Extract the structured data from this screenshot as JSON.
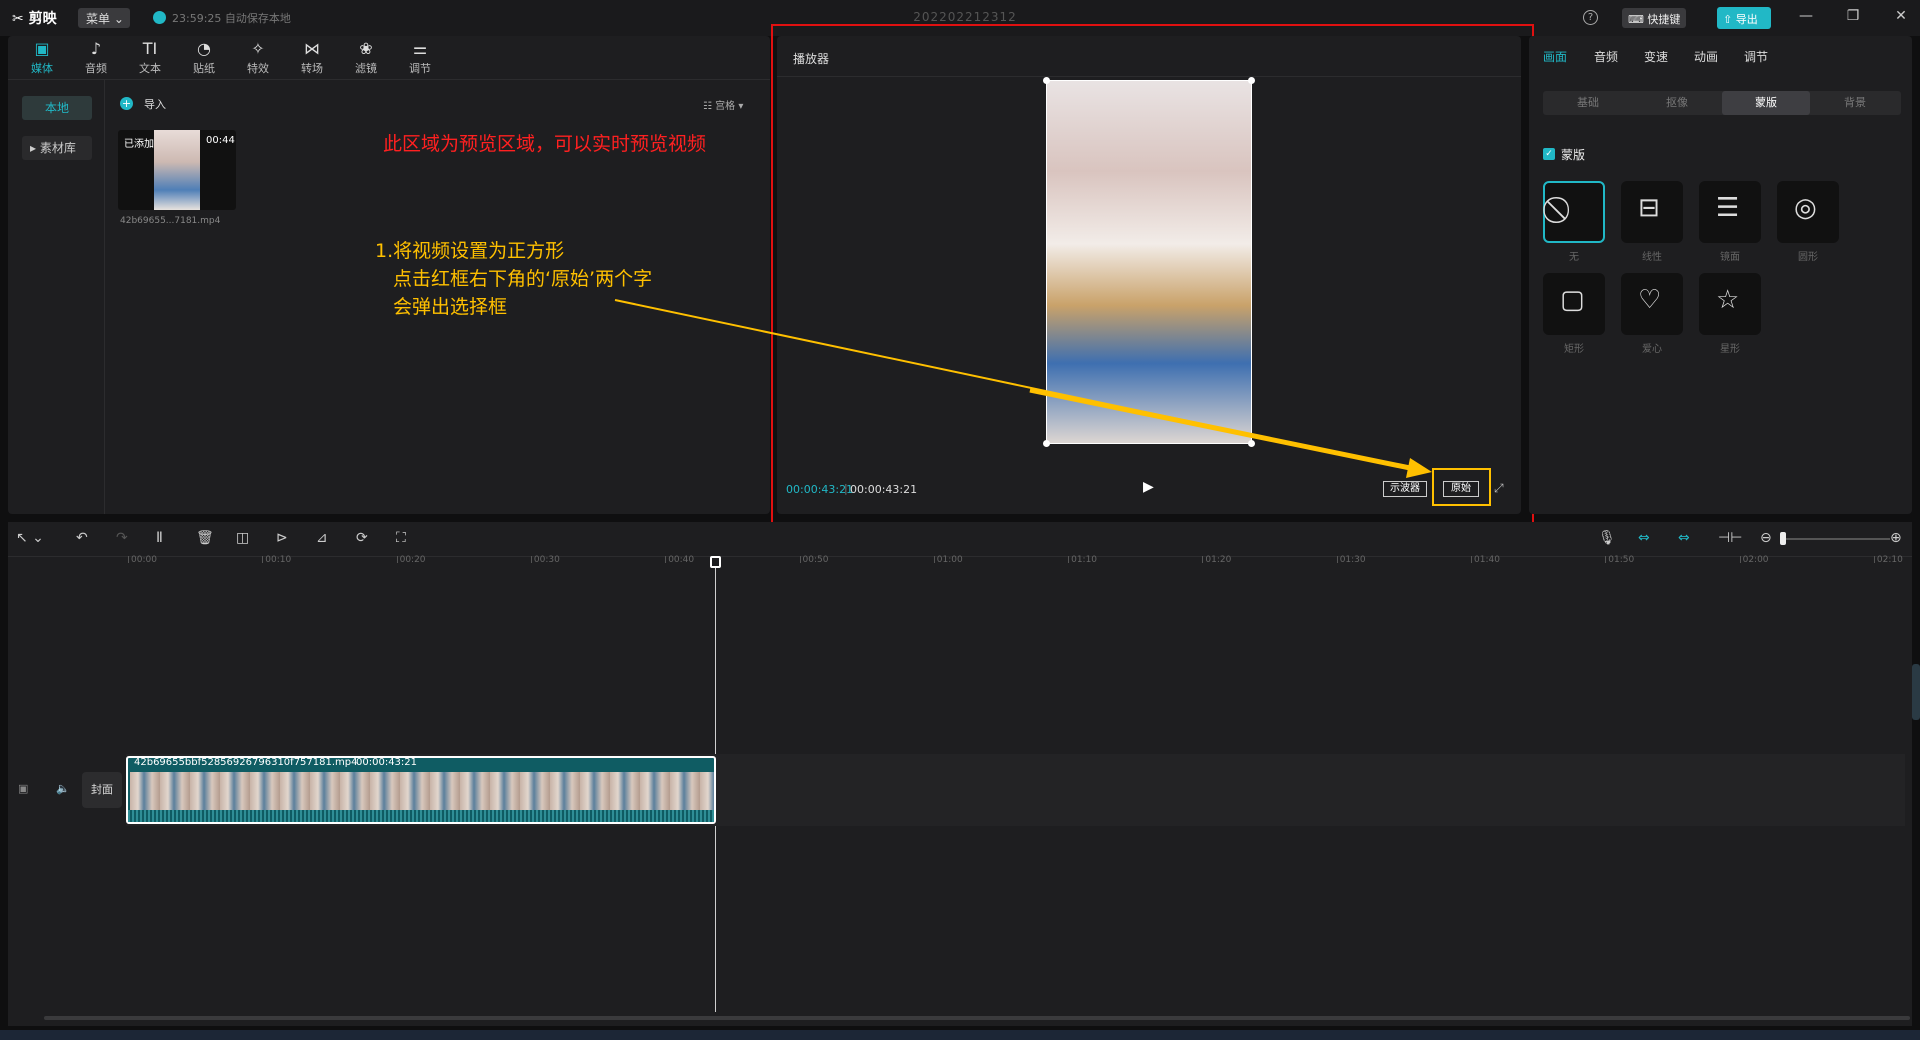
{
  "app": {
    "logo": "✂ 剪映",
    "menu": "菜单 ⌄",
    "save_status": "23:59:25 自动保存本地",
    "project_title": "202202212312",
    "help": "?",
    "shortcut": "⌨ 快捷键",
    "export": "⇧ 导出"
  },
  "window_controls": [
    "—",
    "❐",
    "✕"
  ],
  "tool_tabs": [
    {
      "icon": "▣",
      "label": "媒体"
    },
    {
      "icon": "♪",
      "label": "音频"
    },
    {
      "icon": "TI",
      "label": "文本"
    },
    {
      "icon": "◔",
      "label": "贴纸"
    },
    {
      "icon": "✧",
      "label": "特效"
    },
    {
      "icon": "⋈",
      "label": "转场"
    },
    {
      "icon": "❀",
      "label": "滤镜"
    },
    {
      "icon": "⚌",
      "label": "调节"
    }
  ],
  "media": {
    "nav_local": "本地",
    "nav_library": "▸ 素材库",
    "import": "导入",
    "view_toggle": "☷ 宫格 ▾",
    "thumb_added": "已添加",
    "thumb_duration": "00:44",
    "thumb_name": "42b69655...7181.mp4"
  },
  "annotations": {
    "preview_note": "此区域为预览区域，可以实时预览视频",
    "step_line1": "1.将视频设置为正方形",
    "step_line2": "点击红框右下角的‘原始’两个字",
    "step_line3": "会弹出选择框"
  },
  "player": {
    "title": "播放器",
    "time_current": "00:00:43:21",
    "time_total": "00:00:43:21",
    "play": "▶",
    "scope_btn": "示波器",
    "ratio_btn": "原始",
    "fullscreen": "⤢"
  },
  "right_panel": {
    "tabs": [
      "画面",
      "音频",
      "变速",
      "动画",
      "调节"
    ],
    "subtabs": [
      "基础",
      "抠像",
      "蒙版",
      "背景"
    ],
    "mask_enabled_label": "蒙版",
    "mask_check": "✓",
    "masks": [
      {
        "name": "无",
        "icon": "⃠"
      },
      {
        "name": "线性",
        "icon": "⊟"
      },
      {
        "name": "镜面",
        "icon": "☰"
      },
      {
        "name": "圆形",
        "icon": "◎"
      },
      {
        "name": "矩形",
        "icon": "▢"
      },
      {
        "name": "爱心",
        "icon": "♡"
      },
      {
        "name": "星形",
        "icon": "☆"
      }
    ]
  },
  "timeline": {
    "toolbar_left": [
      "↖ ⌄",
      "↶",
      "↷",
      "Ⅱ",
      "🗑",
      "◫",
      "⊳",
      "⊿",
      "⟳",
      "⛶"
    ],
    "toolbar_right": [
      "🎙",
      "⇔",
      "⇔",
      "⊣⊢",
      "⊖",
      "⊕"
    ],
    "ruler": [
      "00:00",
      "00:10",
      "00:20",
      "00:30",
      "00:40",
      "00:50",
      "01:00",
      "01:10",
      "01:20",
      "01:30",
      "01:40",
      "01:50",
      "02:00",
      "02:10"
    ],
    "cover": "封面",
    "clip_name": "42b69655bbf52856926796310f757181.mp4",
    "clip_duration": "00:00:43:21"
  }
}
